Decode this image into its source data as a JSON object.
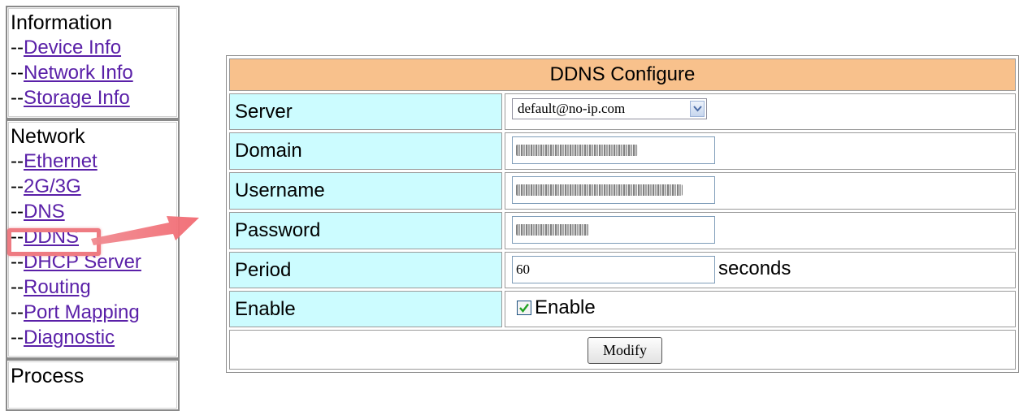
{
  "sidebar": {
    "sections": [
      {
        "title": "Information",
        "items": [
          "Device Info",
          "Network Info",
          "Storage Info"
        ]
      },
      {
        "title": "Network",
        "items": [
          "Ethernet",
          "2G/3G",
          "DNS",
          "DDNS",
          "DHCP Server",
          "Routing",
          "Port Mapping",
          "Diagnostic"
        ]
      },
      {
        "title": "Process",
        "items": []
      }
    ],
    "dash": "--",
    "highlighted_item": "DDNS"
  },
  "form": {
    "title": "DDNS Configure",
    "server": {
      "label": "Server",
      "value": "default@no-ip.com"
    },
    "domain": {
      "label": "Domain",
      "value": ""
    },
    "username": {
      "label": "Username",
      "value": ""
    },
    "password": {
      "label": "Password",
      "value": ""
    },
    "period": {
      "label": "Period",
      "value": "60",
      "unit": "seconds"
    },
    "enable": {
      "label": "Enable",
      "checkbox_label": "Enable",
      "checked": true
    },
    "modify_button": "Modify"
  },
  "colors": {
    "header_bg": "#f8c18c",
    "label_bg": "#ccfcff",
    "highlight": "#ee7b82",
    "link": "#5a20a8"
  },
  "icons": [
    "chevron-down-icon",
    "checkmark-icon",
    "arrow-right-annotation"
  ]
}
